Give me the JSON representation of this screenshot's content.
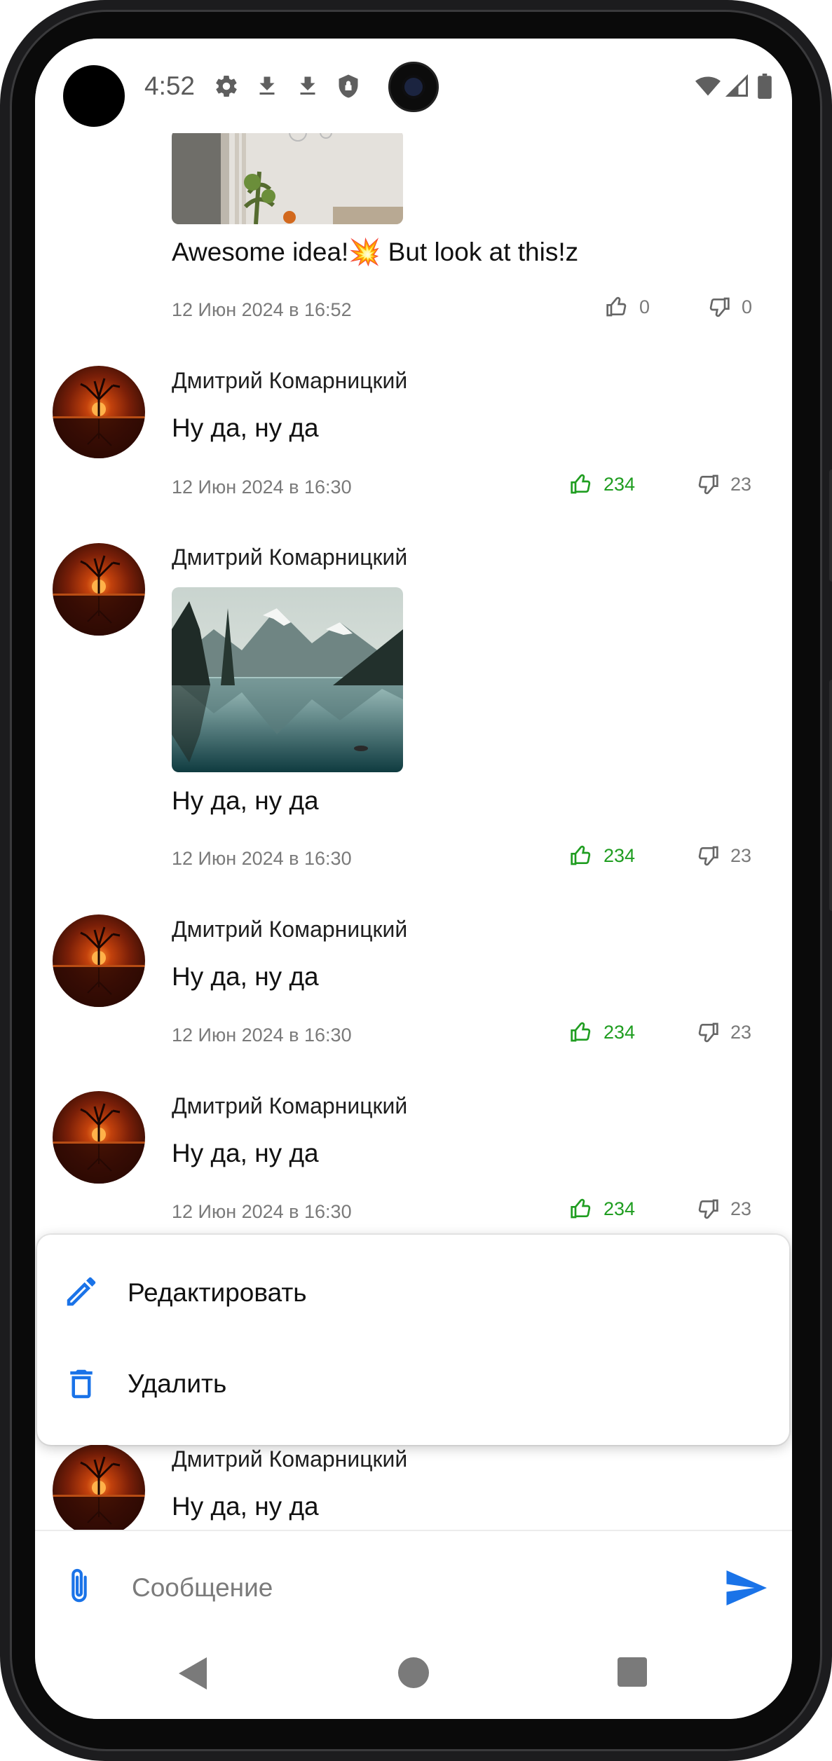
{
  "status_bar": {
    "time": "4:52",
    "left_icons": [
      "settings-icon",
      "download-icon",
      "download-icon",
      "shield-icon"
    ],
    "right_icons": [
      "wifi-icon",
      "signal-icon",
      "battery-icon"
    ]
  },
  "comments": [
    {
      "text": "Awesome idea!💥 But look at this!z",
      "date": "12 Июн 2024 в 16:52",
      "likes": "0",
      "dislikes": "0",
      "liked": false
    },
    {
      "author": "Дмитрий Комарницкий",
      "text": "Ну да, ну да",
      "date": "12 Июн 2024 в 16:30",
      "likes": "234",
      "dislikes": "23",
      "liked": true
    },
    {
      "author": "Дмитрий Комарницкий",
      "text": "Ну да, ну да",
      "date": "12 Июн 2024 в 16:30",
      "likes": "234",
      "dislikes": "23",
      "liked": true
    },
    {
      "author": "Дмитрий Комарницкий",
      "text": "Ну да, ну да",
      "date": "12 Июн 2024 в 16:30",
      "likes": "234",
      "dislikes": "23",
      "liked": true
    },
    {
      "author": "Дмитрий Комарницкий",
      "text": "Ну да, ну да",
      "date": "12 Июн 2024 в 16:30",
      "likes": "234",
      "dislikes": "23",
      "liked": true
    },
    {
      "author": "Дмитрий Комарницкий",
      "text": "Ну да, ну да"
    }
  ],
  "context_menu": {
    "edit_label": "Редактировать",
    "delete_label": "Удалить"
  },
  "composer": {
    "placeholder": "Сообщение"
  },
  "colors": {
    "accent_blue": "#1a73e8",
    "like_green": "#1f9d20",
    "meta_grey": "#7a7a7a"
  }
}
